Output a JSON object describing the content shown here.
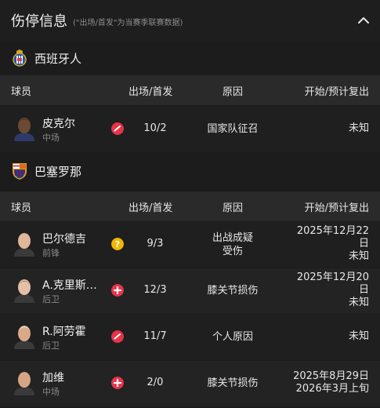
{
  "header": {
    "title": "伤停信息",
    "subtitle": "(\"出场/首发\"为当赛季联赛数据)",
    "collapse_icon": "chevron-up-icon"
  },
  "columns": {
    "player": "球员",
    "apps": "出场/首发",
    "reason": "原因",
    "return": "开始/预计复出"
  },
  "teams": [
    {
      "name": "西班牙人",
      "logo_icon": "espanyol-crest-icon",
      "players": [
        {
          "name": "皮克尔",
          "position": "中场",
          "status": "red-injury",
          "apps": "10/2",
          "reason": [
            "国家队征召"
          ],
          "return": [
            "未知"
          ]
        }
      ]
    },
    {
      "name": "巴塞罗那",
      "logo_icon": "barcelona-crest-icon",
      "players": [
        {
          "name": "巴尔德吉",
          "position": "前锋",
          "status": "doubtful",
          "apps": "9/3",
          "reason": [
            "出战成疑",
            "受伤"
          ],
          "return": [
            "2025年12月22",
            "日",
            "未知"
          ]
        },
        {
          "name": "A.克里斯…",
          "position": "后卫",
          "status": "injured",
          "apps": "12/3",
          "reason": [
            "膝关节损伤"
          ],
          "return": [
            "2025年12月20",
            "日",
            "未知"
          ]
        },
        {
          "name": "R.阿劳霍",
          "position": "后卫",
          "status": "red-injury",
          "apps": "11/7",
          "reason": [
            "个人原因"
          ],
          "return": [
            "未知"
          ]
        },
        {
          "name": "加维",
          "position": "中场",
          "status": "injured",
          "apps": "2/0",
          "reason": [
            "膝关节损伤"
          ],
          "return": [
            "2025年8月29日",
            "2026年3月上旬"
          ]
        }
      ]
    }
  ],
  "colors": {
    "red": "#e8344a",
    "yellow": "#f2b705",
    "header_bg": "#2a2a2a"
  }
}
